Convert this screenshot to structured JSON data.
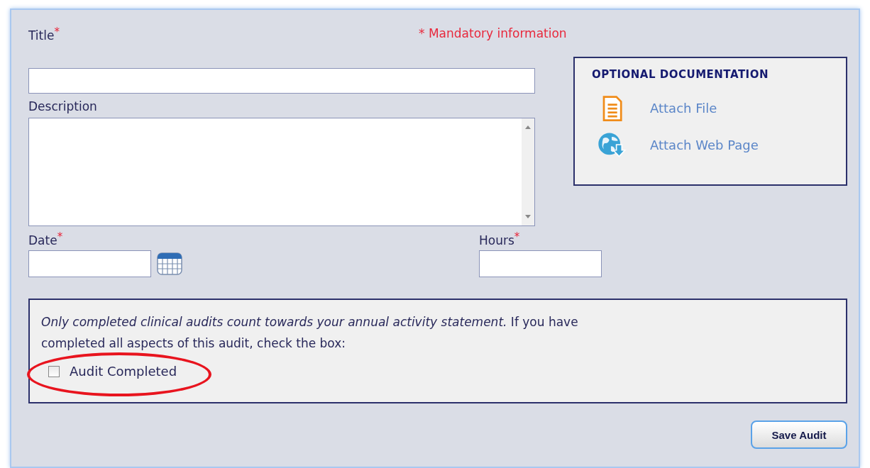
{
  "form": {
    "title_field": {
      "label": "Title",
      "mark": "*"
    },
    "mandatory_note": {
      "mark": "*",
      "text": "Mandatory information"
    },
    "description_field": {
      "label": "Description"
    },
    "date_field": {
      "label": "Date",
      "mark": "*"
    },
    "hours_field": {
      "label": "Hours",
      "mark": "*"
    }
  },
  "optional_documentation": {
    "heading": "OPTIONAL DOCUMENTATION",
    "links": [
      {
        "kind": "file",
        "label": "Attach File"
      },
      {
        "kind": "web",
        "label": "Attach Web Page"
      }
    ]
  },
  "completion": {
    "note": "*Only completed clinical audits count towards your annual activity statement.* If you have completed all aspects of this audit, check the box:",
    "checkbox": {
      "label": "Audit Completed",
      "checked": false,
      "highlighted": true
    }
  },
  "buttons": [
    "Save Audit"
  ]
}
